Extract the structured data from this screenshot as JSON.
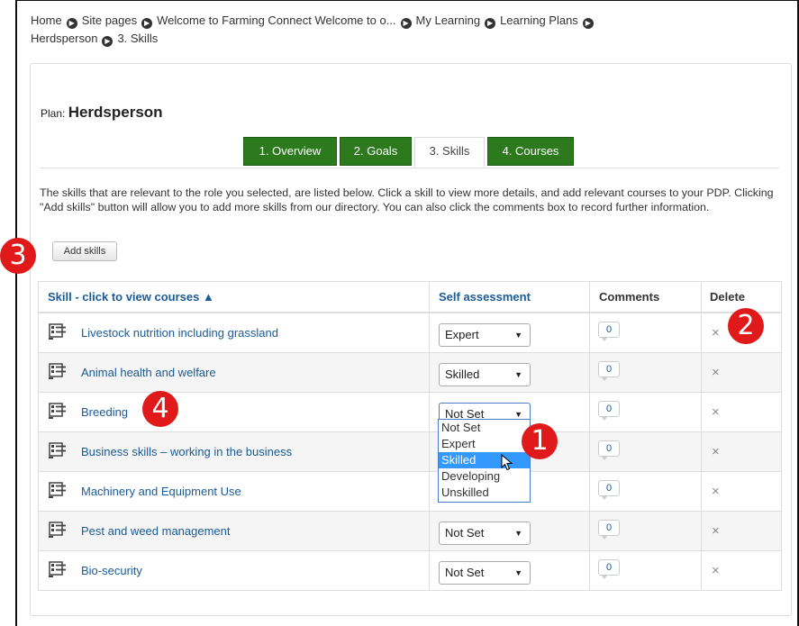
{
  "breadcrumb": {
    "items": [
      "Home",
      "Site pages",
      "Welcome to Farming Connect Welcome to o...",
      "My Learning",
      "Learning Plans",
      "Herdsperson",
      "3. Skills"
    ]
  },
  "plan": {
    "label": "Plan:",
    "name": "Herdsperson"
  },
  "tabs": [
    {
      "label": "1. Overview",
      "state": "inactive"
    },
    {
      "label": "2. Goals",
      "state": "inactive"
    },
    {
      "label": "3. Skills",
      "state": "active"
    },
    {
      "label": "4. Courses",
      "state": "inactive"
    }
  ],
  "intro": "The skills that are relevant to the role you selected, are listed below. Click a skill to view more details, and add relevant courses to your PDP. Clicking \"Add skills\" button will allow you to add more skills from our directory. You can also click the comments box to record further information.",
  "add_skills_label": "Add skills",
  "table": {
    "headers": {
      "skill": "Skill - click to view courses ▲",
      "self": "Self assessment",
      "comments": "Comments",
      "delete": "Delete"
    },
    "rows": [
      {
        "skill": "Livestock nutrition including grassland",
        "assessment": "Expert",
        "comments": "0"
      },
      {
        "skill": "Animal health and welfare",
        "assessment": "Skilled",
        "comments": "0"
      },
      {
        "skill": "Breeding",
        "assessment": "Not Set",
        "comments": "0"
      },
      {
        "skill": "Business skills – working in the business",
        "assessment": "",
        "comments": "0"
      },
      {
        "skill": "Machinery and Equipment Use",
        "assessment": "",
        "comments": "0"
      },
      {
        "skill": "Pest and weed management",
        "assessment": "Not Set",
        "comments": "0"
      },
      {
        "skill": "Bio-security",
        "assessment": "Not Set",
        "comments": "0"
      }
    ],
    "delete_glyph": "×",
    "caret_glyph": "▼"
  },
  "dropdown_options": [
    "Not Set",
    "Expert",
    "Skilled",
    "Developing",
    "Unskilled"
  ],
  "dropdown_highlighted": "Skilled",
  "callouts": [
    "1",
    "2",
    "3",
    "4"
  ],
  "colors": {
    "tab_green": "#2d7a1e",
    "link_blue": "#1a5a96",
    "callout_red": "#e01a1a",
    "highlight": "#3399ff"
  }
}
